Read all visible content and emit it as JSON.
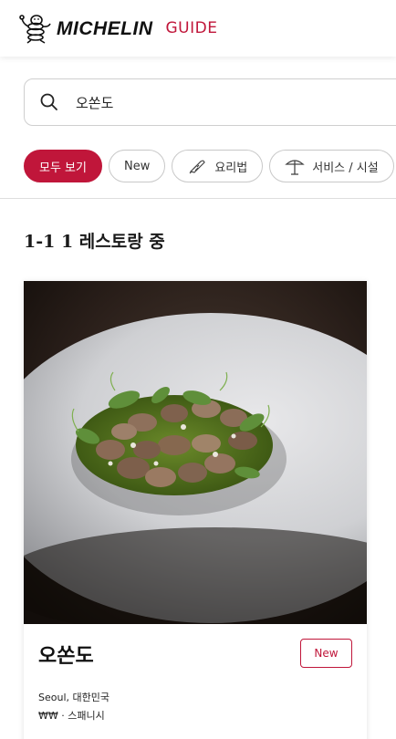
{
  "header": {
    "brand": "MICHELIN",
    "guide_label": "GUIDE"
  },
  "search": {
    "value": "오쏜도"
  },
  "filters": [
    {
      "label": "모두 보기",
      "active": true
    },
    {
      "label": "New",
      "active": false
    },
    {
      "label": "요리법",
      "icon": "cuisine-icon",
      "active": false
    },
    {
      "label": "서비스 / 시설",
      "icon": "umbrella-icon",
      "active": false
    }
  ],
  "results": {
    "summary": "1-1 1 레스토랑 중"
  },
  "card": {
    "name": "오쏜도",
    "badge": "New",
    "location": "Seoul, 대한민국",
    "price_cuisine": "₩₩ · 스패니시",
    "image_icon": "dish-photo"
  },
  "colors": {
    "brand_red": "#c0163a"
  }
}
